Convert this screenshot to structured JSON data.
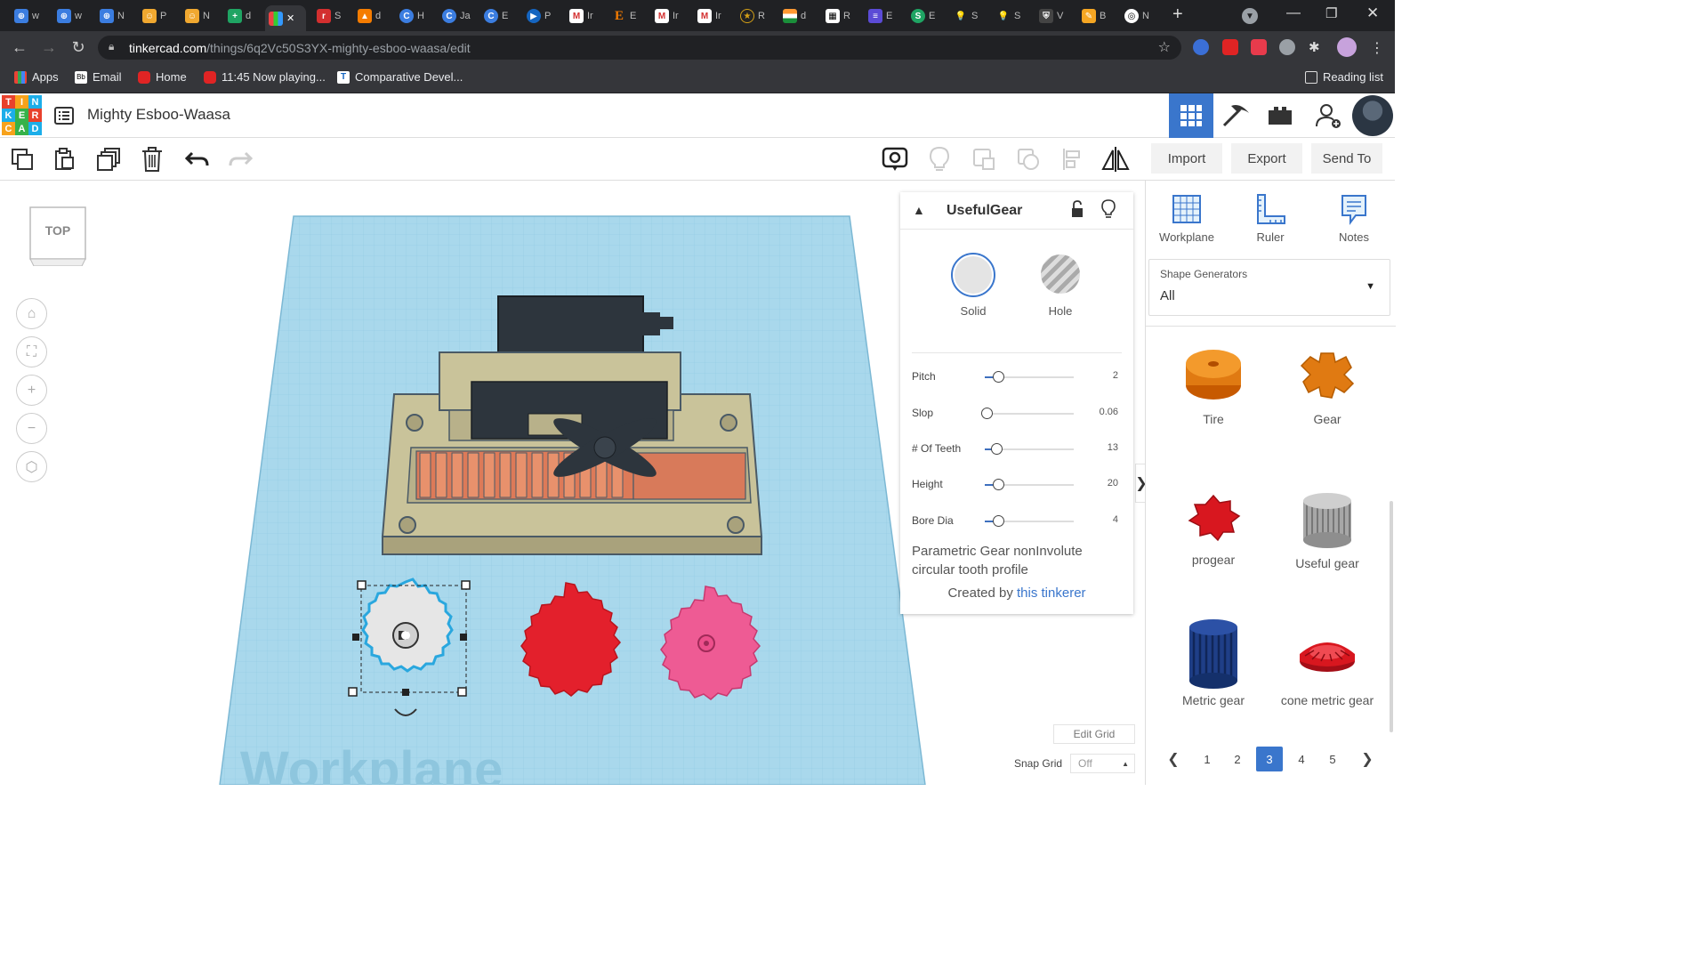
{
  "browser": {
    "tabs": [
      "w",
      "w",
      "N",
      "P",
      "N",
      "d",
      "",
      "S",
      "d",
      "H",
      "Ja",
      "E",
      "P",
      "Ir",
      "E",
      "Ir",
      "Ir",
      "R",
      "d",
      "R",
      "E",
      "E",
      "S",
      "S",
      "V",
      "B",
      "N"
    ],
    "new_tab": "+",
    "url_domain": "tinkercad.com",
    "url_path": "/things/6q2Vc50S3YX-mighty-esboo-waasa/edit",
    "bookmarks": [
      "Apps",
      "Email",
      "Home",
      "11:45 Now playing...",
      "Comparative Devel..."
    ],
    "reading_list": "Reading list"
  },
  "app": {
    "logo": [
      "T",
      "I",
      "N",
      "K",
      "E",
      "R",
      "C",
      "A",
      "D"
    ],
    "title": "Mighty Esboo-Waasa"
  },
  "toolbar": {
    "import": "Import",
    "export": "Export",
    "send_to": "Send To"
  },
  "viewcube": {
    "label": "TOP"
  },
  "workplane": {
    "watermark": "Workplane"
  },
  "inspector": {
    "name": "UsefulGear",
    "solid": "Solid",
    "hole": "Hole",
    "params": [
      {
        "label": "Pitch",
        "value": "2",
        "frac": 0.15
      },
      {
        "label": "Slop",
        "value": "0.06",
        "frac": 0.02
      },
      {
        "label": "# Of Teeth",
        "value": "13",
        "frac": 0.13
      },
      {
        "label": "Height",
        "value": "20",
        "frac": 0.15
      },
      {
        "label": "Bore Dia",
        "value": "4",
        "frac": 0.15
      }
    ],
    "description": "Parametric Gear nonInvolute circular tooth profile",
    "created_by": "Created by",
    "author": "this tinkerer"
  },
  "right_panel": {
    "workplane": "Workplane",
    "ruler": "Ruler",
    "notes": "Notes",
    "generators_label": "Shape Generators",
    "generators_value": "All",
    "shapes": [
      "Tire",
      "Gear",
      "progear",
      "Useful gear",
      "Metric gear",
      "cone metric gear"
    ],
    "pages": [
      "1",
      "2",
      "3",
      "4",
      "5"
    ],
    "current_page": "3"
  },
  "grid": {
    "edit_grid": "Edit Grid",
    "snap_label": "Snap Grid",
    "snap_value": "Off"
  },
  "colors": {
    "accent": "#3a76cc",
    "workplane": "#a9d8ec",
    "red_gear": "#e3202c",
    "pink_gear": "#ee5b94",
    "grey_gear": "#e6e6e6"
  }
}
